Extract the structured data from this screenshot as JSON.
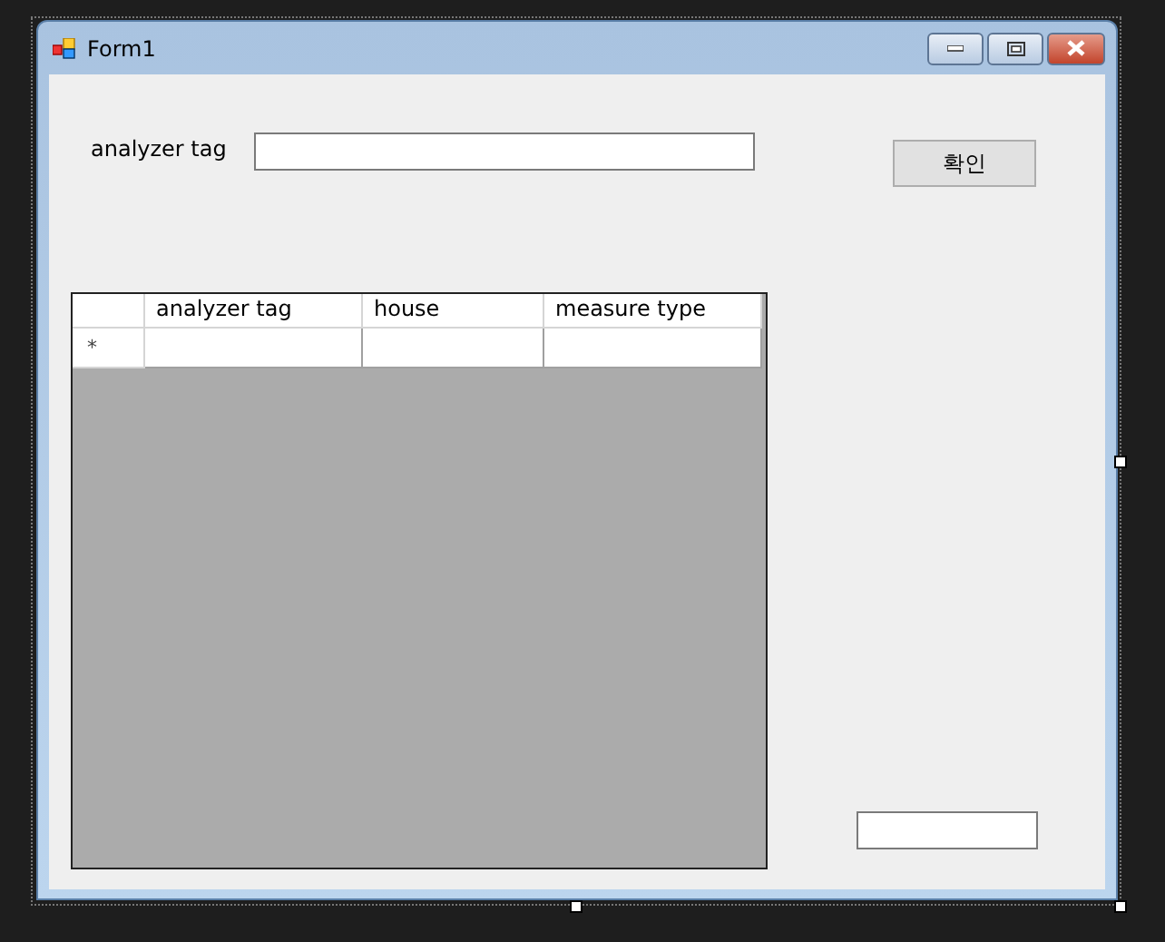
{
  "window": {
    "title": "Form1"
  },
  "tag_label": "analyzer tag",
  "confirm_button": "확인",
  "grid": {
    "columns": [
      "analyzer tag",
      "house",
      "measure type"
    ],
    "rows": [
      {
        "marker": "*",
        "cells": [
          "",
          "",
          ""
        ]
      }
    ]
  }
}
